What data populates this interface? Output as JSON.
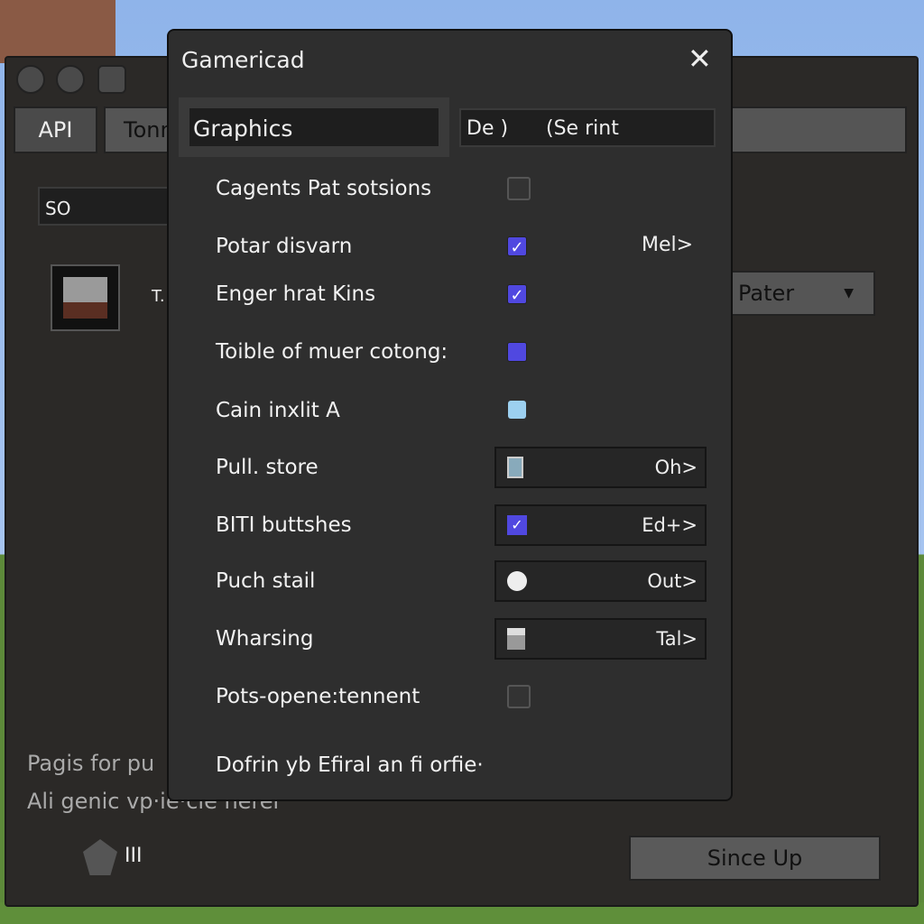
{
  "background_window": {
    "tabs": [
      "API",
      "Tonn"
    ],
    "search_value": "SO",
    "item_label": "T.",
    "dropdown_value": "Pater",
    "footer_lines": [
      "Pagis for pu",
      "Ali genic vp·ie·cle herer"
    ],
    "footer_icon_label": "III",
    "primary_button": "Since Up"
  },
  "dialog": {
    "title": "Gamericad",
    "category_value": "Graphics",
    "preset_value": "De )      (Se rint",
    "rows": [
      {
        "label": "Cagents Pat sotsions",
        "control": "checkbox",
        "checked": false
      },
      {
        "label": "Potar disvarn",
        "control": "checkbox",
        "checked": true,
        "side": "Mel>"
      },
      {
        "label": "Enger hrat Kins",
        "control": "checkbox",
        "checked": true
      },
      {
        "label": "Toible of muer cotong:",
        "control": "checkbox",
        "checked": "indeterminate"
      },
      {
        "label": "Cain inxlit A",
        "control": "icon",
        "icon": "printer-icon"
      },
      {
        "label": "Pull. store",
        "control": "button",
        "icon": "phone-icon",
        "value": "Oh>"
      },
      {
        "label": "BITI buttshes",
        "control": "button",
        "icon": "checkbox-checked-icon",
        "value": "Ed+>"
      },
      {
        "label": "Puch stail",
        "control": "button",
        "icon": "circle-icon",
        "value": "Out>"
      },
      {
        "label": "Wharsing",
        "control": "button",
        "icon": "block-icon",
        "value": "Tal>"
      },
      {
        "label": "Pots-opene:tennent",
        "control": "checkbox",
        "checked": false
      },
      {
        "label": "Dofrin yb Efiral an fi orfie·",
        "control": "none"
      }
    ],
    "accent": "#5048e0"
  }
}
